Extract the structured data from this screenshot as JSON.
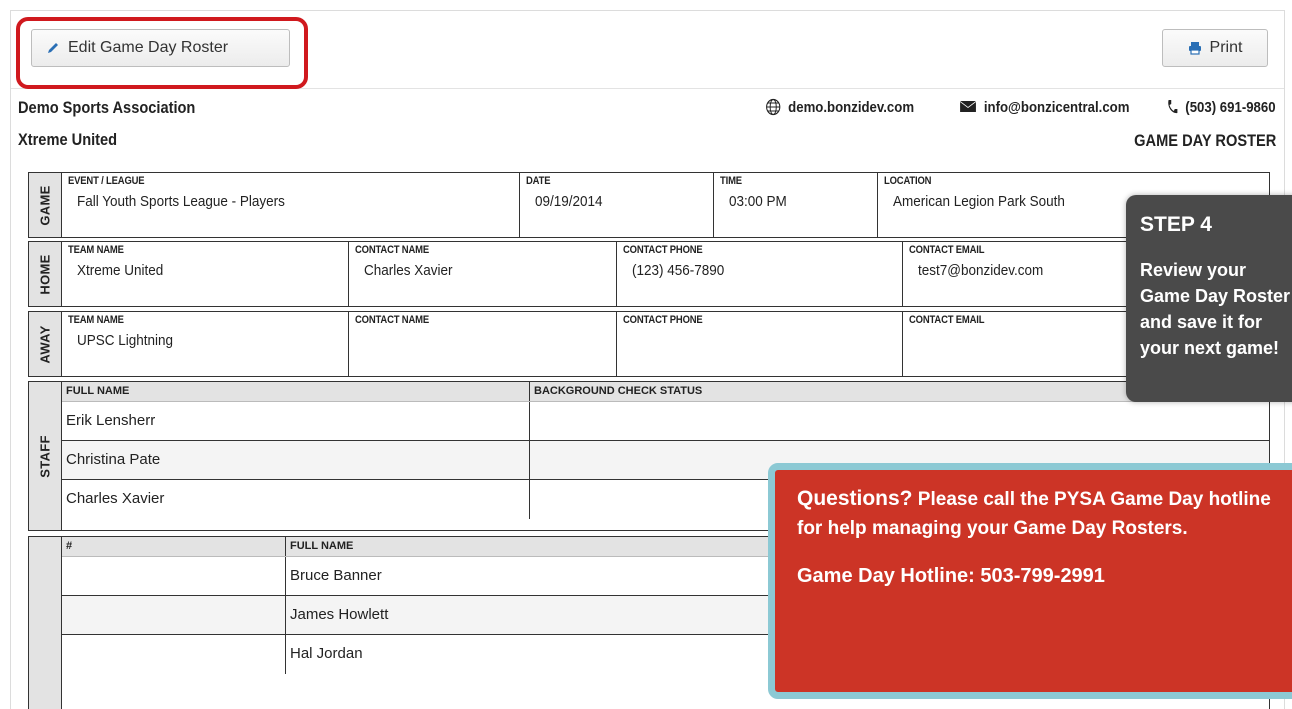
{
  "toolbar": {
    "edit_label": "Edit Game Day Roster",
    "print_label": "Print"
  },
  "header": {
    "org_name": "Demo Sports Association",
    "team_name": "Xtreme United",
    "website": "demo.bonzidev.com",
    "email": "info@bonzicentral.com",
    "phone": "(503) 691-9860",
    "doc_title": "GAME DAY ROSTER"
  },
  "game": {
    "side_label": "GAME",
    "event_label": "EVENT / LEAGUE",
    "event_value": "Fall Youth Sports League - Players",
    "date_label": "DATE",
    "date_value": "09/19/2014",
    "time_label": "TIME",
    "time_value": "03:00 PM",
    "location_label": "LOCATION",
    "location_value": "American Legion Park South"
  },
  "home": {
    "side_label": "HOME",
    "team_label": "TEAM NAME",
    "team_value": "Xtreme United",
    "contact_label": "CONTACT NAME",
    "contact_value": "Charles Xavier",
    "phone_label": "CONTACT PHONE",
    "phone_value": "(123) 456-7890",
    "email_label": "CONTACT EMAIL",
    "email_value": "test7@bonzidev.com"
  },
  "away": {
    "side_label": "AWAY",
    "team_label": "TEAM NAME",
    "team_value": "UPSC Lightning",
    "contact_label": "CONTACT NAME",
    "contact_value": "",
    "phone_label": "CONTACT PHONE",
    "phone_value": "",
    "email_label": "CONTACT EMAIL",
    "email_value": ""
  },
  "staff": {
    "side_label": "STAFF",
    "col_name": "FULL NAME",
    "col_bg": "BACKGROUND CHECK STATUS",
    "rows": [
      "Erik Lensherr",
      "Christina Pate",
      "Charles Xavier"
    ]
  },
  "players": {
    "col_num": "#",
    "col_name": "FULL NAME",
    "rows": [
      "Bruce Banner",
      "James Howlett",
      "Hal Jordan"
    ]
  },
  "tooltip_step": {
    "heading": "STEP 4",
    "body": "Review your Game Day Roster and save it for your next game!"
  },
  "tooltip_questions": {
    "lead": "Questions?",
    "text": "Please call the PYSA Game Day hotline for help managing your Game Day Rosters.",
    "hotline": "Game Day Hotline: 503-799-2991"
  },
  "colors": {
    "highlight": "#d0191e",
    "step_bg": "#4a4a4a",
    "questions_bg": "#cc3426",
    "questions_border": "#8cc9d4"
  }
}
